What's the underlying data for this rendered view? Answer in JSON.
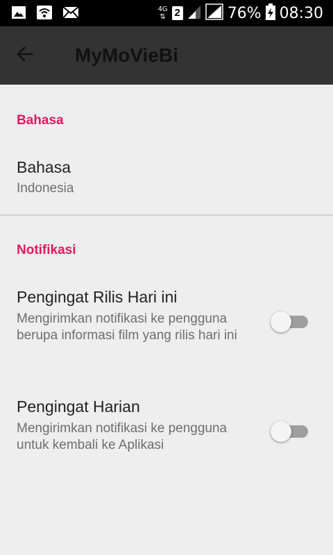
{
  "status_bar": {
    "network": "4G",
    "sim_slot": "2",
    "battery": "76%",
    "time": "08:30",
    "icons": [
      "gallery-icon",
      "wifi-icon",
      "mail-icon",
      "signal-icon",
      "signal-full-icon",
      "battery-charging-icon"
    ]
  },
  "app_bar": {
    "title": "MyMoVieBi",
    "back_icon": "arrow-back-icon"
  },
  "sections": {
    "language": {
      "header": "Bahasa",
      "item": {
        "title": "Bahasa",
        "summary": "Indonesia"
      }
    },
    "notifications": {
      "header": "Notifikasi",
      "release_reminder": {
        "title": "Pengingat Rilis Hari ini",
        "summary": "Mengirimkan notifikasi ke pengguna berupa informasi film yang rilis hari ini",
        "enabled": false
      },
      "daily_reminder": {
        "title": "Pengingat Harian",
        "summary": "Mengirimkan notifikasi ke pengguna untuk kembali ke Aplikasi",
        "enabled": false
      }
    }
  },
  "colors": {
    "accent": "#e0185f",
    "app_bar": "#333333",
    "background": "#eeeeee"
  }
}
